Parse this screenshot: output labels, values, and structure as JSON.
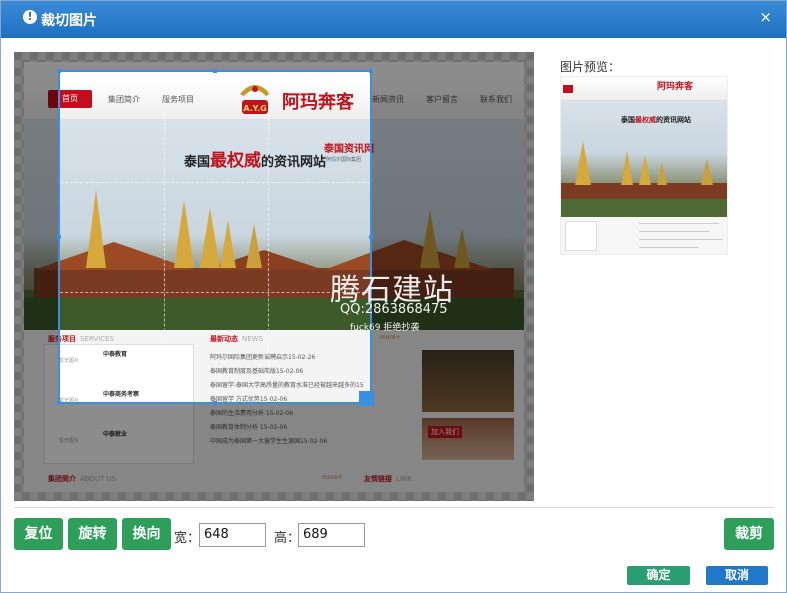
{
  "dialog": {
    "title": "裁切图片",
    "close_glyph": "×",
    "title_icon": "!"
  },
  "site": {
    "nav": {
      "home": "首页",
      "items": [
        "集团简介",
        "服务项目",
        "新闻资讯",
        "客户留言",
        "联系我们"
      ]
    },
    "logo_text": "阿玛奔客",
    "logo_badge": "A.Y.G",
    "banner": {
      "title_prefix": "泰国",
      "title_emphasis": "最权威",
      "title_suffix": "的资讯网站",
      "side_title": "泰国资讯网",
      "side_sub": "阿玛尔国际集团"
    },
    "sections": {
      "services": "服务项目",
      "services_en": "SERVICES",
      "news": "最新动态",
      "news_en": "NEWS",
      "more": "more+",
      "about": "集团简介",
      "about_en": "ABOUT US",
      "links": "友情链接",
      "links_en": "LINK",
      "no_image": "暂无图片",
      "join_us": "加入我们"
    },
    "service_items": [
      "中泰教育",
      "中泰商务考察",
      "中泰就业"
    ],
    "news_items": [
      "阿玛尔国际集团更新诚聘启示15-02-26",
      "泰国教育制度及基础简版15-02-06",
      "泰国留学:泰国大学高质量的教育水准已经被越来越多的15",
      "泰国留学 方式优势15-02-06",
      "泰国的生活费用分析 15-02-06",
      "泰国教育体制分析 15-02-06",
      "中国成为泰国第一大留学生生源国15-02-06"
    ]
  },
  "watermark": {
    "main": "腾石建站",
    "qq": "QQ:2863868475",
    "tag": "fuck69 拒绝抄袭"
  },
  "preview": {
    "label": "图片预览："
  },
  "toolbar": {
    "reset": "复位",
    "rotate": "旋转",
    "swap": "换向",
    "width_label": "宽：",
    "width_value": "648",
    "height_label": "高：",
    "height_value": "689",
    "crop": "裁剪"
  },
  "footer": {
    "ok": "确定",
    "cancel": "取消"
  },
  "colors": {
    "title_bar": "#1f6fc2",
    "green_button": "#2e9e5b",
    "ok_button": "#2a9d72",
    "cancel_button": "#1f78c9",
    "crop_border": "#3b8fe0",
    "brand_red": "#c0141c"
  }
}
